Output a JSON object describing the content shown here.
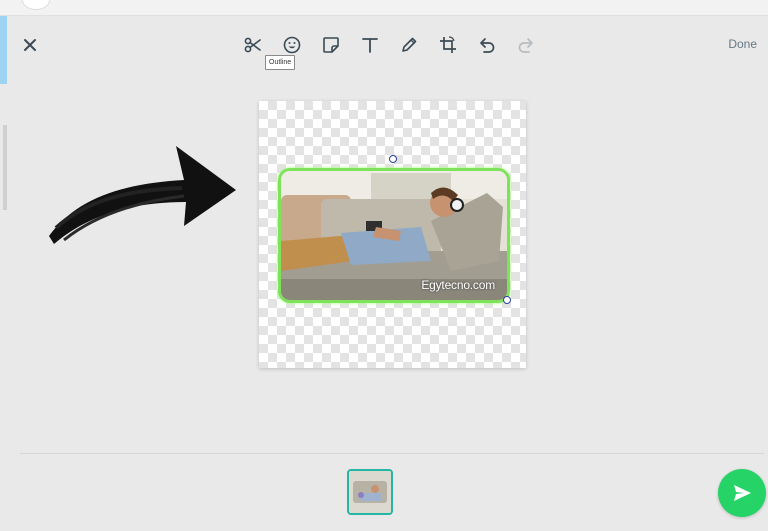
{
  "toolbar": {
    "tools": [
      {
        "icon": "scissors-icon"
      },
      {
        "icon": "emoji-icon"
      },
      {
        "icon": "sticker-icon"
      },
      {
        "icon": "text-icon"
      },
      {
        "icon": "pencil-icon"
      },
      {
        "icon": "crop-rotate-icon"
      },
      {
        "icon": "undo-icon"
      },
      {
        "icon": "redo-icon"
      }
    ],
    "tooltip": "Outline",
    "done_label": "Done"
  },
  "canvas": {
    "watermark": "Egytecno.com"
  },
  "colors": {
    "accent": "#25d366",
    "outline": "#7ee35a",
    "thumb_border": "#25b6a4"
  }
}
